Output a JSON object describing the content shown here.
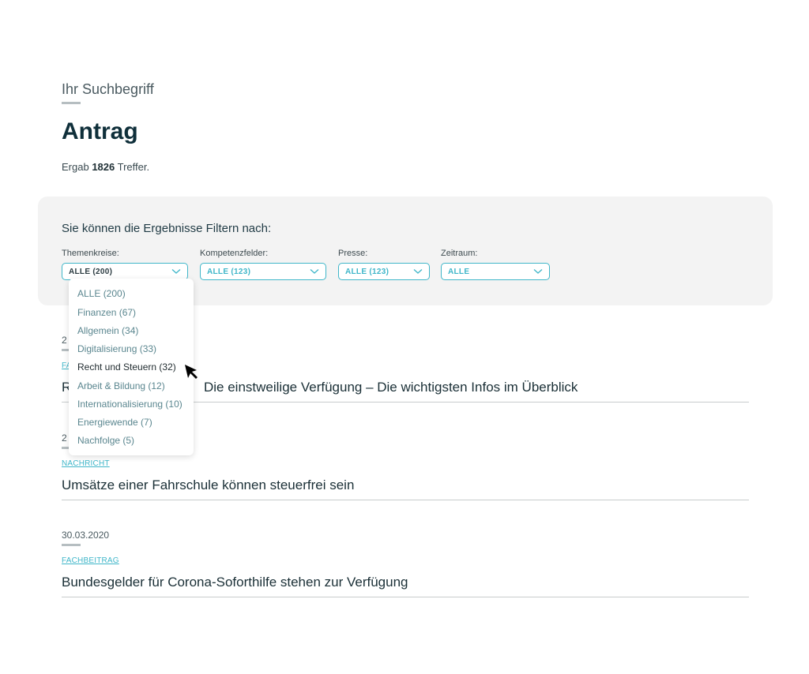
{
  "search": {
    "label": "Ihr Suchbegriff",
    "term": "Antrag",
    "count_prefix": "Ergab",
    "count_value": "1826",
    "count_suffix": "Treffer."
  },
  "filters": {
    "heading": "Sie können die Ergebnisse Filtern nach:",
    "groups": [
      {
        "label": "Themenkreise:",
        "value": "ALLE (200)"
      },
      {
        "label": "Kompetenzfelder:",
        "value": "ALLE (123)"
      },
      {
        "label": "Presse:",
        "value": "ALLE (123)"
      },
      {
        "label": "Zeitraum:",
        "value": "ALLE"
      }
    ],
    "dropdown_items": [
      "ALLE (200)",
      "Finanzen (67)",
      "Allgemein (34)",
      "Digitalisierung (33)",
      "Recht und Steuern (32)",
      "Arbeit & Bildung (12)",
      "Internationalisierung (10)",
      "Energiewende (7)",
      "Nachfolge (5)"
    ]
  },
  "results": [
    {
      "date": "2",
      "category": "FA",
      "title": "R",
      "title_tail": "Die einstweilige Verfügung – Die wichtigsten Infos im Überblick"
    },
    {
      "date": "2",
      "category": "NACHRICHT",
      "title": "Umsätze einer Fahrschule können steuerfrei sein"
    },
    {
      "date": "30.03.2020",
      "category": "FACHBEITRAG",
      "title": "Bundesgelder für Corona-Soforthilfe stehen zur Verfügung"
    }
  ],
  "colors": {
    "accent": "#3fb6c9",
    "panel": "#f3f3f3",
    "title": "#0f2f3a"
  }
}
